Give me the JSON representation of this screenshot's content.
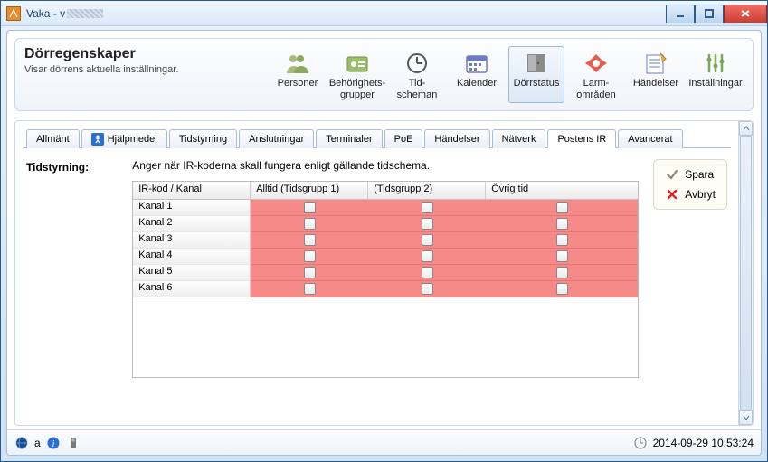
{
  "window": {
    "title_prefix": "Vaka - v"
  },
  "ribbon": {
    "title": "Dörregenskaper",
    "subtitle": "Visar dörrens aktuella inställningar.",
    "items": [
      {
        "label": "Personer"
      },
      {
        "label": "Behörighets-\ngrupper"
      },
      {
        "label": "Tid-\nscheman"
      },
      {
        "label": "Kalender"
      },
      {
        "label": "Dörrstatus",
        "active": true
      },
      {
        "label": "Larm-\nområden"
      },
      {
        "label": "Händelser"
      },
      {
        "label": "Inställningar"
      }
    ]
  },
  "tabs": [
    {
      "label": "Allmänt"
    },
    {
      "label": "Hjälpmedel",
      "accessibility_icon": true
    },
    {
      "label": "Tidstyrning"
    },
    {
      "label": "Anslutningar"
    },
    {
      "label": "Terminaler"
    },
    {
      "label": "PoE"
    },
    {
      "label": "Händelser"
    },
    {
      "label": "Nätverk"
    },
    {
      "label": "Postens IR",
      "active": true
    },
    {
      "label": "Avancerat"
    }
  ],
  "section": {
    "label": "Tidstyrning:",
    "description": "Anger när IR-koderna skall fungera enligt gällande tidschema.",
    "columns": [
      "IR-kod / Kanal",
      "Alltid (Tidsgrupp 1)",
      "(Tidsgrupp 2)",
      "Övrig tid"
    ],
    "rows": [
      "Kanal 1",
      "Kanal 2",
      "Kanal 3",
      "Kanal 4",
      "Kanal 5",
      "Kanal 6"
    ]
  },
  "side": {
    "save": "Spara",
    "cancel": "Avbryt"
  },
  "status": {
    "left_text": "a",
    "timestamp": "2014-09-29 10:53:24"
  }
}
